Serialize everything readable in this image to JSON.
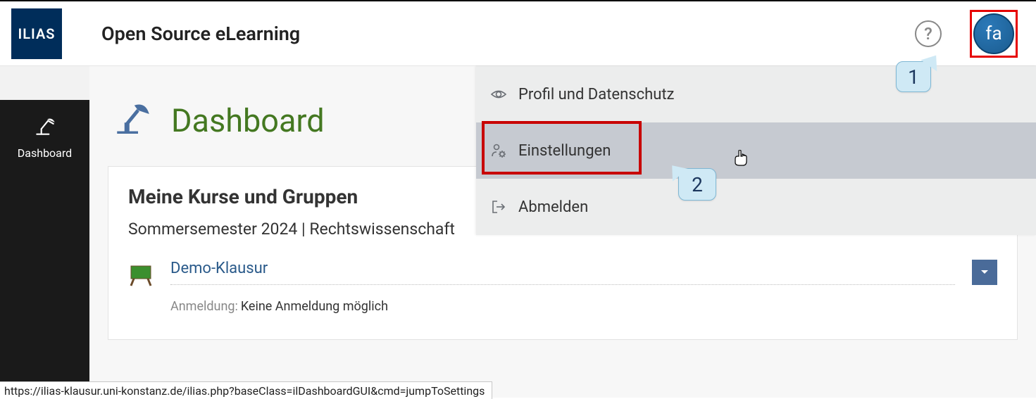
{
  "header": {
    "logo_text": "ILIAS",
    "title": "Open Source eLearning",
    "help_symbol": "?",
    "avatar_initials": "fa"
  },
  "sidebar": {
    "dashboard_label": "Dashboard"
  },
  "page": {
    "title": "Dashboard"
  },
  "card": {
    "title": "Meine Kurse und Gruppen",
    "subtitle": "Sommersemester 2024 | Rechtswissenschaft"
  },
  "course": {
    "link": "Demo-Klausur",
    "meta_label": "Anmeldung:",
    "meta_value": "Keine Anmeldung möglich"
  },
  "dropdown": {
    "item_profile": "Profil und Datenschutz",
    "item_settings": "Einstellungen",
    "item_logout": "Abmelden"
  },
  "callouts": {
    "one": "1",
    "two": "2"
  },
  "status_url": "https://ilias-klausur.uni-konstanz.de/ilias.php?baseClass=ilDashboardGUI&cmd=jumpToSettings"
}
